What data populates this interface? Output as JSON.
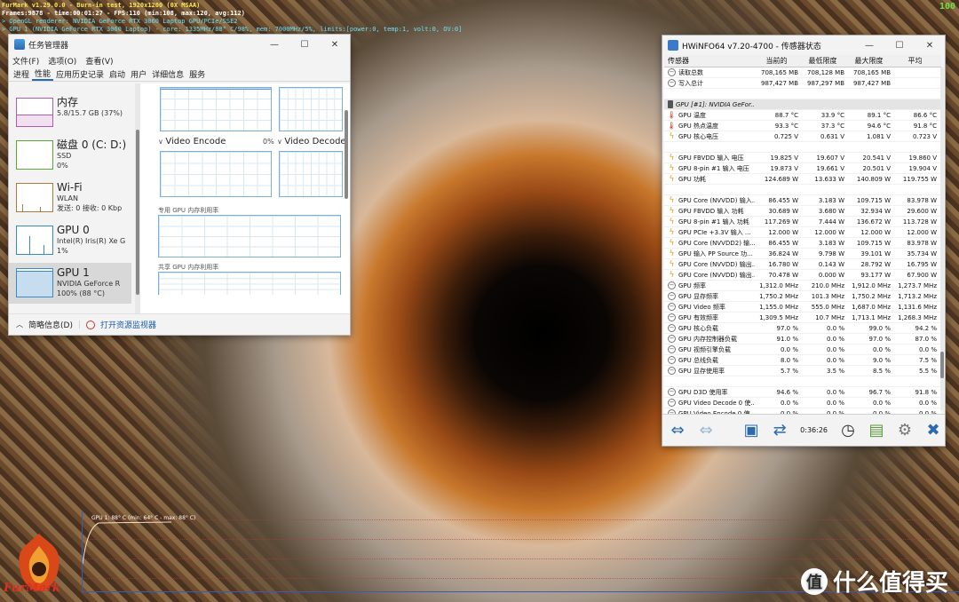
{
  "furmark": {
    "title_line": "FurMark v1.29.0.0 - Burn-in test, 1920x1200 (0X MSAA)",
    "frames_line": "Frames:9878 - time:00:01:27 - FPS:110 (min:108, max:120, avg:112)",
    "opengl_line": "> OpenGL renderer: NVIDIA GeForce RTX 3060 Laptop GPU/PCIe/SSE2",
    "gpu_line": "> GPU 1 (NVIDIA GeForce RTX 3060 Laptop) - core: 1335MHz/88° C/98%, mem: 7000MHz/5%, limits:[power:0, temp:1, volt:0, OV:0]",
    "corner_label": "100",
    "graph_label": "GPU 1: 88° C (min: 64° C - max: 88° C)",
    "logo_text": "FurMark"
  },
  "watermark": {
    "icon_glyph": "值",
    "text": "什么值得买"
  },
  "taskmgr": {
    "title": "任务管理器",
    "controls": {
      "minimize": "—",
      "maximize": "☐",
      "close": "✕"
    },
    "menu": [
      "文件(F)",
      "选项(O)",
      "查看(V)"
    ],
    "tabs": [
      "进程",
      "性能",
      "应用历史记录",
      "启动",
      "用户",
      "详细信息",
      "服务"
    ],
    "active_tab_index": 1,
    "resources": [
      {
        "name": "内存",
        "sub1": "5.8/15.7 GB (37%)",
        "sub2": "",
        "sub3": "",
        "color": "#b05ab0"
      },
      {
        "name": "磁盘 0 (C: D:)",
        "sub1": "SSD",
        "sub2": "0%",
        "sub3": "",
        "color": "#5aa83a"
      },
      {
        "name": "Wi-Fi",
        "sub1": "WLAN",
        "sub2": "发送: 0 接收: 0 Kbp",
        "sub3": "",
        "color": "#b07a3a"
      },
      {
        "name": "GPU 0",
        "sub1": "Intel(R) Iris(R) Xe G",
        "sub2": "1%",
        "sub3": "",
        "color": "#3a8ac8"
      },
      {
        "name": "GPU 1",
        "sub1": "NVIDIA GeForce R",
        "sub2": "100% (88 °C)",
        "sub3": "",
        "color": "#3a8ac8"
      }
    ],
    "video_encode_label": "Video Encode",
    "video_encode_value": "0%",
    "video_decode_label": "Video Decode",
    "dedicated_mem_label": "专用 GPU 内存利用率",
    "shared_mem_label": "共享 GPU 内存利用率",
    "footer_summary": "简略信息(D)",
    "footer_link": "打开资源监视器"
  },
  "hwinfo": {
    "title": "HWiNFO64 v7.20-4700 - 传感器状态",
    "headers": [
      "传感器",
      "当前的",
      "最低限度",
      "最大限度",
      "平均"
    ],
    "rows": [
      {
        "icon": "circle",
        "name": "读取总数",
        "cur": "708,165 MB",
        "min": "708,128 MB",
        "max": "708,165 MB",
        "avg": ""
      },
      {
        "icon": "circle",
        "name": "写入总计",
        "cur": "987,427 MB",
        "min": "987,297 MB",
        "max": "987,427 MB",
        "avg": ""
      },
      {
        "icon": "blank",
        "name": "",
        "cur": "",
        "min": "",
        "max": "",
        "avg": ""
      },
      {
        "icon": "gpu",
        "name": "GPU [#1]: NVIDIA GeFor...",
        "cur": "",
        "min": "",
        "max": "",
        "avg": "",
        "group": true
      },
      {
        "icon": "temp",
        "name": "GPU 温度",
        "cur": "88.7 °C",
        "min": "33.9 °C",
        "max": "89.1 °C",
        "avg": "86.6 °C"
      },
      {
        "icon": "temp",
        "name": "GPU 热点温度",
        "cur": "93.3 °C",
        "min": "37.3 °C",
        "max": "94.6 °C",
        "avg": "91.8 °C"
      },
      {
        "icon": "bolt",
        "name": "GPU 核心电压",
        "cur": "0.725 V",
        "min": "0.631 V",
        "max": "1.081 V",
        "avg": "0.723 V"
      },
      {
        "icon": "blank",
        "name": "",
        "cur": "",
        "min": "",
        "max": "",
        "avg": ""
      },
      {
        "icon": "bolt",
        "name": "GPU FBVDD 输入 电压",
        "cur": "19.825 V",
        "min": "19.607 V",
        "max": "20.541 V",
        "avg": "19.860 V"
      },
      {
        "icon": "bolt",
        "name": "GPU 8-pin #1 输入 电压",
        "cur": "19.873 V",
        "min": "19.661 V",
        "max": "20.501 V",
        "avg": "19.904 V"
      },
      {
        "icon": "bolt",
        "name": "GPU 功耗",
        "cur": "124.689 W",
        "min": "13.633 W",
        "max": "140.809 W",
        "avg": "119.755 W"
      },
      {
        "icon": "blank",
        "name": "",
        "cur": "",
        "min": "",
        "max": "",
        "avg": ""
      },
      {
        "icon": "bolt",
        "name": "GPU Core (NVVDD) 输入...",
        "cur": "86.455 W",
        "min": "3.183 W",
        "max": "109.715 W",
        "avg": "83.978 W"
      },
      {
        "icon": "bolt",
        "name": "GPU FBVDD 输入 功耗",
        "cur": "30.689 W",
        "min": "3.680 W",
        "max": "32.934 W",
        "avg": "29.600 W"
      },
      {
        "icon": "bolt",
        "name": "GPU 8-pin #1 输入 功耗",
        "cur": "117.269 W",
        "min": "7.444 W",
        "max": "136.672 W",
        "avg": "113.728 W"
      },
      {
        "icon": "bolt",
        "name": "GPU PCIe +3.3V 输入 ...",
        "cur": "12.000 W",
        "min": "12.000 W",
        "max": "12.000 W",
        "avg": "12.000 W"
      },
      {
        "icon": "bolt",
        "name": "GPU Core (NVVDD2) 输...",
        "cur": "86.455 W",
        "min": "3.183 W",
        "max": "109.715 W",
        "avg": "83.978 W"
      },
      {
        "icon": "bolt",
        "name": "GPU 输入 PP Source 功...",
        "cur": "36.824 W",
        "min": "9.798 W",
        "max": "39.101 W",
        "avg": "35.734 W"
      },
      {
        "icon": "bolt",
        "name": "GPU Core (NVVDD) 输出...",
        "cur": "16.780 W",
        "min": "0.143 W",
        "max": "28.792 W",
        "avg": "16.795 W"
      },
      {
        "icon": "bolt",
        "name": "GPU Core (NVVDD) 输出...",
        "cur": "70.478 W",
        "min": "0.000 W",
        "max": "93.177 W",
        "avg": "67.900 W"
      },
      {
        "icon": "circle",
        "name": "GPU 频率",
        "cur": "1,312.0 MHz",
        "min": "210.0 MHz",
        "max": "1,912.0 MHz",
        "avg": "1,273.7 MHz"
      },
      {
        "icon": "circle",
        "name": "GPU 显存频率",
        "cur": "1,750.2 MHz",
        "min": "101.3 MHz",
        "max": "1,750.2 MHz",
        "avg": "1,713.2 MHz"
      },
      {
        "icon": "circle",
        "name": "GPU Video 频率",
        "cur": "1,155.0 MHz",
        "min": "555.0 MHz",
        "max": "1,687.0 MHz",
        "avg": "1,131.6 MHz"
      },
      {
        "icon": "circle",
        "name": "GPU 有效频率",
        "cur": "1,309.5 MHz",
        "min": "10.7 MHz",
        "max": "1,713.1 MHz",
        "avg": "1,268.3 MHz"
      },
      {
        "icon": "circle",
        "name": "GPU 核心负载",
        "cur": "97.0 %",
        "min": "0.0 %",
        "max": "99.0 %",
        "avg": "94.2 %"
      },
      {
        "icon": "circle",
        "name": "GPU 内存控制器负载",
        "cur": "91.0 %",
        "min": "0.0 %",
        "max": "97.0 %",
        "avg": "87.0 %"
      },
      {
        "icon": "circle",
        "name": "GPU 视频引擎负载",
        "cur": "0.0 %",
        "min": "0.0 %",
        "max": "0.0 %",
        "avg": "0.0 %"
      },
      {
        "icon": "circle",
        "name": "GPU 总线负载",
        "cur": "8.0 %",
        "min": "0.0 %",
        "max": "9.0 %",
        "avg": "7.5 %"
      },
      {
        "icon": "circle",
        "name": "GPU 显存使用率",
        "cur": "5.7 %",
        "min": "3.5 %",
        "max": "8.5 %",
        "avg": "5.5 %"
      },
      {
        "icon": "blank",
        "name": "",
        "cur": "",
        "min": "",
        "max": "",
        "avg": ""
      },
      {
        "icon": "circle",
        "name": "GPU D3D 使用率",
        "cur": "94.6 %",
        "min": "0.0 %",
        "max": "96.7 %",
        "avg": "91.8 %"
      },
      {
        "icon": "circle",
        "name": "GPU Video Decode 0 使...",
        "cur": "0.0 %",
        "min": "0.0 %",
        "max": "0.0 %",
        "avg": "0.0 %"
      },
      {
        "icon": "circle",
        "name": "GPU Video Encode 0 使...",
        "cur": "0.0 %",
        "min": "0.0 %",
        "max": "0.0 %",
        "avg": "0.0 %"
      }
    ],
    "timer": "0:36:26"
  }
}
